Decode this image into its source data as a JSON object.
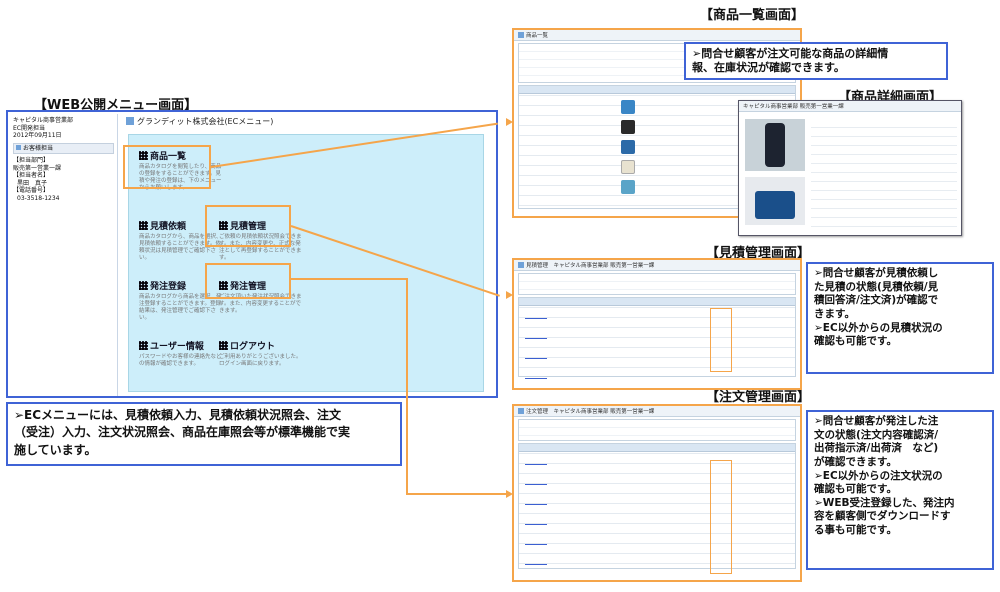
{
  "titles": {
    "menu": "【WEB公開メニュー画面】",
    "product_list": "【商品一覧画面】",
    "product_detail": "【商品詳細画面】",
    "estimate": "【見積管理画面】",
    "order": "【注文管理画面】"
  },
  "menu_window": {
    "sidebar": {
      "company": "キャピタル商事営業部",
      "sub": "EC開発担当",
      "date": "2012年09月11日",
      "button": "お客様担当",
      "dept_label": "【担当部門】",
      "dept": "販売第一営業一課",
      "person_label": "【担当者名】",
      "person": "黒田　真子",
      "phone_label": "【電話番号】",
      "phone": "03-3518-1234"
    },
    "header": "グランディット株式会社(ECメニュー)",
    "items": [
      {
        "title": "商品一覧",
        "desc": "商品カタログを閲覧したり、商品の登録をすることができます。見積や発注の登録は、下のメニューからお願いします。"
      },
      {
        "title": "見積依頼",
        "desc": "商品カタログから、商品を選択、見積依頼することができます。依頼状況は見積管理でご確認下さい。"
      },
      {
        "title": "見積管理",
        "desc": "ご依頼の見積依頼状況照会できます。また、内容変更や、正式な発注として再登録することができます。"
      },
      {
        "title": "発注登録",
        "desc": "商品カタログから商品を選択、発注登録することができます。登録結果は、発注管理でご確認下さい。"
      },
      {
        "title": "発注管理",
        "desc": "ご注文頂いた発注状況照会できます。また、内容変更することができます。"
      },
      {
        "title": "ユーザー情報",
        "desc": "パスワードやお客様の連絡先などの情報が確認できます。"
      },
      {
        "title": "ログアウト",
        "desc": "ご利用ありがとうございました。ログイン画面に戻ります。"
      }
    ]
  },
  "callouts": {
    "menu": [
      "➢ECメニューには、見積依頼入力、見積依頼状況照会、注文",
      "（受注）入力、注文状況照会、商品在庫照会等が標準機能で実",
      "施しています。"
    ],
    "product": [
      "➢問合せ顧客が注文可能な商品の詳細情",
      "報、在庫状況が確認できます。"
    ],
    "estimate": [
      "➢問合せ顧客が見積依頼し",
      "た見積の状態(見積依頼/見",
      "積回答済/注文済)が確認で",
      "きます。",
      "➢EC以外からの見積状況の",
      "確認も可能です。"
    ],
    "order": [
      "➢問合せ顧客が発注した注",
      "文の状態(注文内容確認済/",
      "出荷指示済/出荷済　など)",
      "が確認できます。",
      "➢EC以外からの注文状況の",
      "確認も可能です。",
      "➢WEB受注登録した、発注内",
      "容を顧客側でダウンロードす",
      "る事も可能です。"
    ]
  },
  "screens": {
    "product_list_title": "商品一覧",
    "estimate_title": "見積管理",
    "estimate_header": "キャピタル商事営業部 販売第一営業一課",
    "order_title": "注文管理",
    "order_header": "キャピタル商事営業部 販売第一営業一課",
    "detail_header": "キャピタル商事営業部 販売第一営業一課"
  },
  "colors": {
    "border_blue": "#3f63d6",
    "highlight_orange": "#f5a54a",
    "menu_bg": "#cdeefa"
  }
}
